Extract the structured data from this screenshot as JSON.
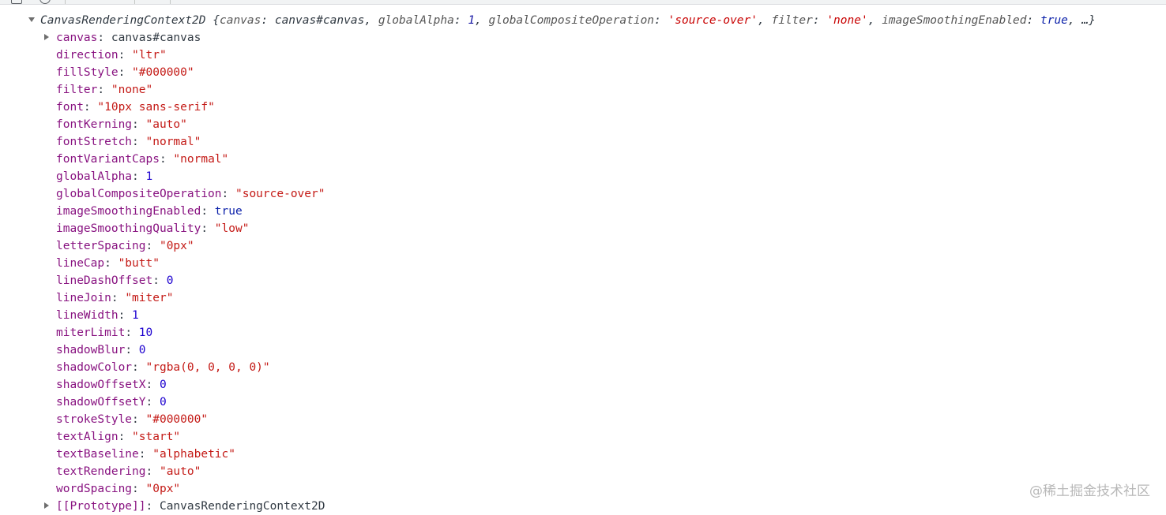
{
  "summary": {
    "class_name": "CanvasRenderingContext2D",
    "preview": [
      {
        "key": "canvas",
        "value": "canvas#canvas",
        "type": "plain"
      },
      {
        "key": "globalAlpha",
        "value": "1",
        "type": "num"
      },
      {
        "key": "globalCompositeOperation",
        "value": "'source-over'",
        "type": "str"
      },
      {
        "key": "filter",
        "value": "'none'",
        "type": "str"
      },
      {
        "key": "imageSmoothingEnabled",
        "value": "true",
        "type": "kw"
      }
    ],
    "ellipsis": "…}"
  },
  "properties": [
    {
      "key": "canvas",
      "value": "canvas#canvas",
      "type": "obj",
      "expandable": true
    },
    {
      "key": "direction",
      "value": "\"ltr\"",
      "type": "str"
    },
    {
      "key": "fillStyle",
      "value": "\"#000000\"",
      "type": "str"
    },
    {
      "key": "filter",
      "value": "\"none\"",
      "type": "str"
    },
    {
      "key": "font",
      "value": "\"10px sans-serif\"",
      "type": "str"
    },
    {
      "key": "fontKerning",
      "value": "\"auto\"",
      "type": "str"
    },
    {
      "key": "fontStretch",
      "value": "\"normal\"",
      "type": "str"
    },
    {
      "key": "fontVariantCaps",
      "value": "\"normal\"",
      "type": "str"
    },
    {
      "key": "globalAlpha",
      "value": "1",
      "type": "num"
    },
    {
      "key": "globalCompositeOperation",
      "value": "\"source-over\"",
      "type": "str"
    },
    {
      "key": "imageSmoothingEnabled",
      "value": "true",
      "type": "kw"
    },
    {
      "key": "imageSmoothingQuality",
      "value": "\"low\"",
      "type": "str"
    },
    {
      "key": "letterSpacing",
      "value": "\"0px\"",
      "type": "str"
    },
    {
      "key": "lineCap",
      "value": "\"butt\"",
      "type": "str"
    },
    {
      "key": "lineDashOffset",
      "value": "0",
      "type": "num"
    },
    {
      "key": "lineJoin",
      "value": "\"miter\"",
      "type": "str"
    },
    {
      "key": "lineWidth",
      "value": "1",
      "type": "num"
    },
    {
      "key": "miterLimit",
      "value": "10",
      "type": "num"
    },
    {
      "key": "shadowBlur",
      "value": "0",
      "type": "num"
    },
    {
      "key": "shadowColor",
      "value": "\"rgba(0, 0, 0, 0)\"",
      "type": "str"
    },
    {
      "key": "shadowOffsetX",
      "value": "0",
      "type": "num"
    },
    {
      "key": "shadowOffsetY",
      "value": "0",
      "type": "num"
    },
    {
      "key": "strokeStyle",
      "value": "\"#000000\"",
      "type": "str"
    },
    {
      "key": "textAlign",
      "value": "\"start\"",
      "type": "str"
    },
    {
      "key": "textBaseline",
      "value": "\"alphabetic\"",
      "type": "str"
    },
    {
      "key": "textRendering",
      "value": "\"auto\"",
      "type": "str"
    },
    {
      "key": "wordSpacing",
      "value": "\"0px\"",
      "type": "str"
    },
    {
      "key": "[[Prototype]]",
      "value": "CanvasRenderingContext2D",
      "type": "obj",
      "expandable": true
    }
  ],
  "watermark": "@稀土掘金技术社区",
  "colors": {
    "key": "#881280",
    "string": "#c41a16",
    "number": "#1c00cf",
    "keyword": "#0d22aa",
    "summary_string": "#c80000",
    "text": "#303942"
  }
}
